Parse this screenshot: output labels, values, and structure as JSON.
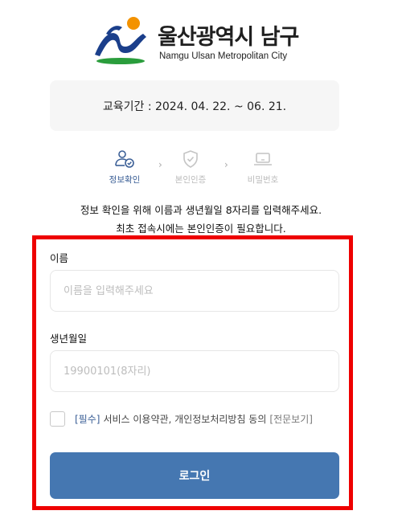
{
  "header": {
    "org_name": "울산광역시 남구",
    "org_name_en": "Namgu Ulsan Metropolitan City"
  },
  "period": {
    "text": "교육기간 : 2024. 04. 22. ~ 06. 21."
  },
  "steps": [
    {
      "label": "정보확인",
      "icon": "user-check-icon",
      "state": "active"
    },
    {
      "label": "본인인증",
      "icon": "shield-check-icon",
      "state": "inactive"
    },
    {
      "label": "비밀번호",
      "icon": "laptop-icon",
      "state": "inactive"
    }
  ],
  "notice": {
    "line1": "정보 확인을 위해 이름과 생년월일 8자리를 입력해주세요.",
    "line2": "최초 접속시에는 본인인증이 필요합니다."
  },
  "form": {
    "name_label": "이름",
    "name_placeholder": "이름을 입력해주세요",
    "birth_label": "생년월일",
    "birth_placeholder": "19900101(8자리)",
    "agree_required": "[필수]",
    "agree_text": "서비스 이용약관, 개인정보처리방침 동의",
    "agree_link": "[전문보기]",
    "submit_label": "로그인"
  },
  "colors": {
    "accent": "#4577b1",
    "highlight_border": "#ee0000",
    "logo_orange": "#f39200",
    "logo_navy": "#1b3f8b",
    "logo_green": "#2a9d3c"
  }
}
